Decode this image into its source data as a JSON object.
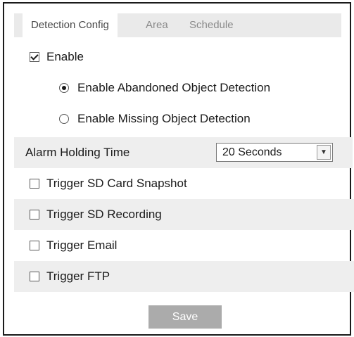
{
  "tabs": [
    {
      "label": "Detection Config",
      "active": true
    },
    {
      "label": "Area",
      "active": false
    },
    {
      "label": "Schedule",
      "active": false
    }
  ],
  "enable": {
    "label": "Enable",
    "checked": true
  },
  "detection_mode": {
    "options": [
      {
        "label": "Enable Abandoned Object Detection",
        "selected": true
      },
      {
        "label": "Enable Missing Object Detection",
        "selected": false
      }
    ]
  },
  "alarm_holding_time": {
    "label": "Alarm Holding Time",
    "value": "20 Seconds"
  },
  "triggers": [
    {
      "label": "Trigger SD Card Snapshot",
      "checked": false
    },
    {
      "label": "Trigger SD Recording",
      "checked": false
    },
    {
      "label": "Trigger Email",
      "checked": false
    },
    {
      "label": "Trigger FTP",
      "checked": false
    }
  ],
  "save_label": "Save",
  "colors": {
    "tab_bar": "#eaeaea",
    "shaded_row": "#eeeeee",
    "save_button": "#ababab"
  }
}
